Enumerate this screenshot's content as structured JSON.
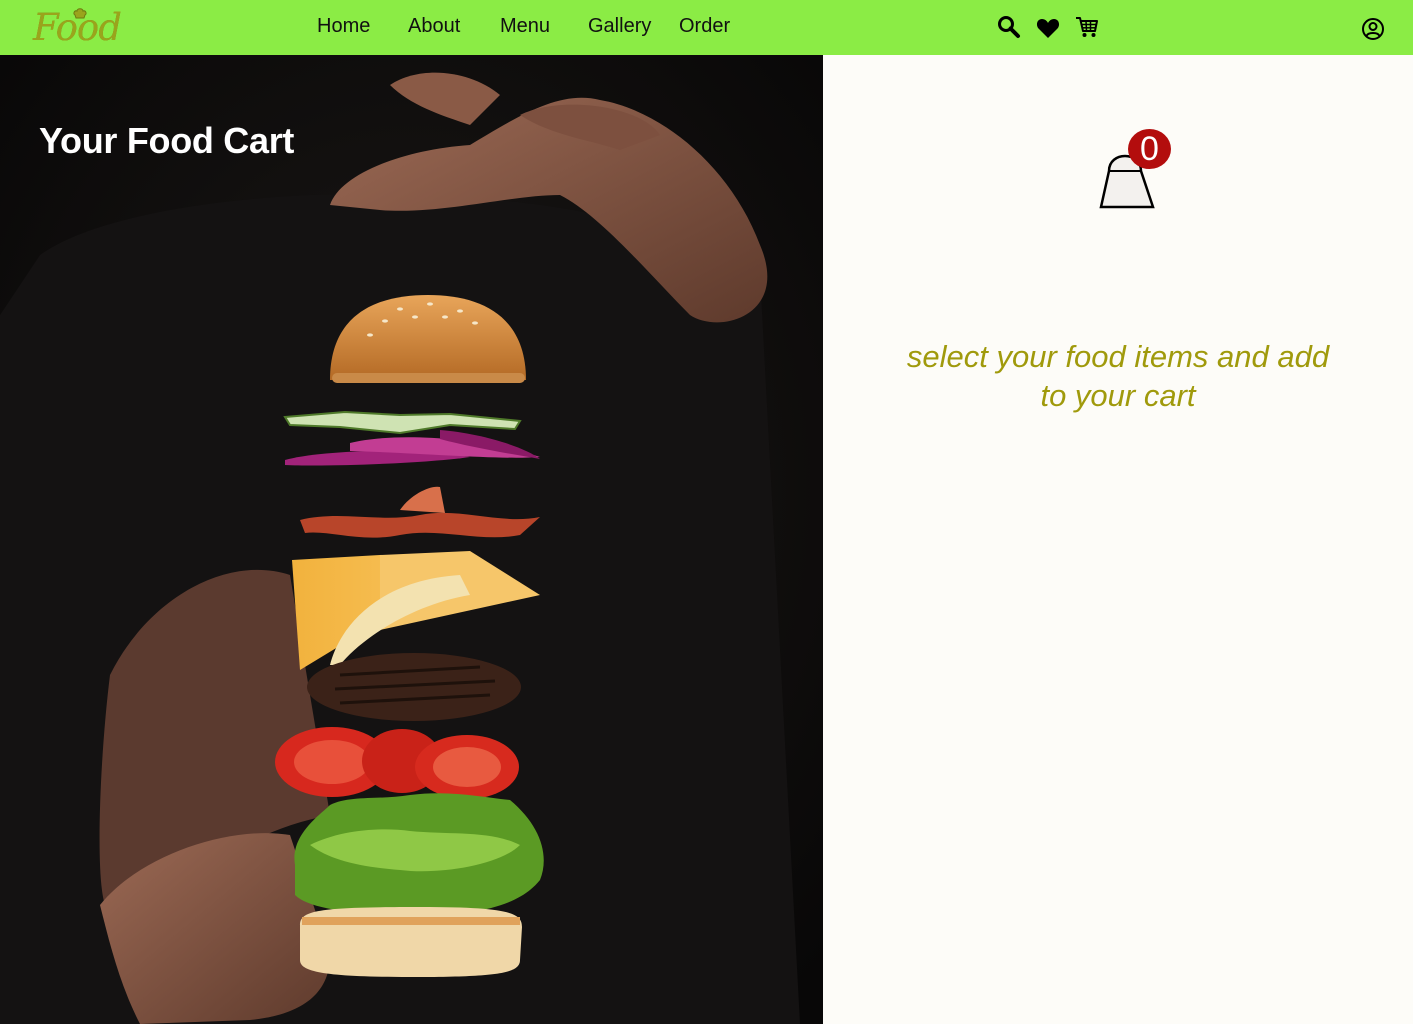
{
  "brand": {
    "name": "Food"
  },
  "nav": {
    "links": [
      "Home",
      "About",
      "Menu",
      "Gallery",
      "Order"
    ],
    "icons": [
      "search-icon",
      "heart-icon",
      "cart-icon",
      "user-icon"
    ]
  },
  "hero": {
    "title": "Your Food Cart"
  },
  "cart": {
    "count": "0",
    "empty_message": "select your food items and add to your cart"
  },
  "colors": {
    "nav_bg": "#8bec45",
    "accent_text": "#a09a0c",
    "badge": "#b30d0d",
    "hero_bg": "#0d0b0a",
    "panel_bg": "#fdfcf8"
  }
}
